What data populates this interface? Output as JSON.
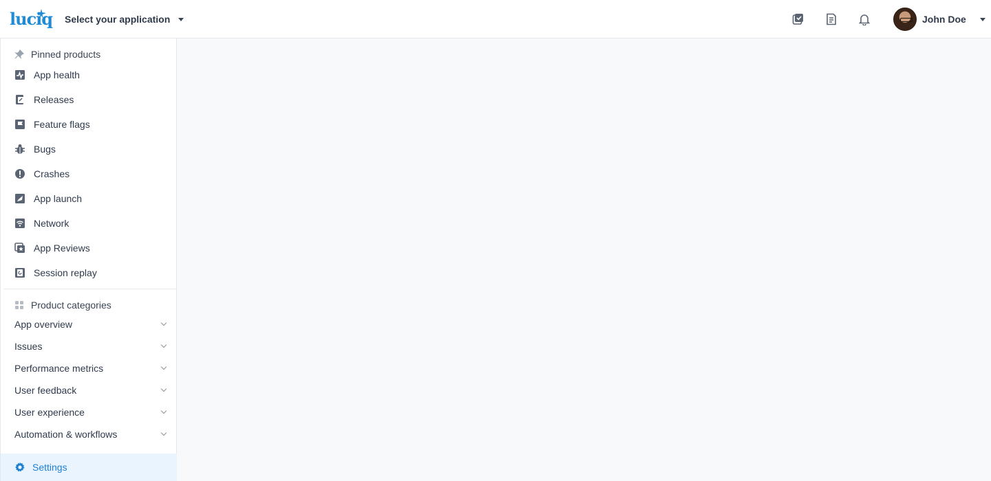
{
  "brand": {
    "logo_text": "luciq",
    "accent": "#1f8bd6"
  },
  "header": {
    "app_selector_label": "Select your application",
    "icons": [
      "tasks-icon",
      "notes-icon",
      "bell-icon"
    ],
    "user_name": "John Doe"
  },
  "sidebar": {
    "pinned_heading": "Pinned products",
    "pinned_items": [
      {
        "label": "App health",
        "icon": "app-health-icon"
      },
      {
        "label": "Releases",
        "icon": "releases-icon"
      },
      {
        "label": "Feature flags",
        "icon": "flag-icon"
      },
      {
        "label": "Bugs",
        "icon": "bug-icon"
      },
      {
        "label": "Crashes",
        "icon": "crash-icon"
      },
      {
        "label": "App launch",
        "icon": "rocket-icon"
      },
      {
        "label": "Network",
        "icon": "wifi-icon"
      },
      {
        "label": "App Reviews",
        "icon": "star-icon"
      },
      {
        "label": "Session replay",
        "icon": "replay-icon"
      }
    ],
    "categories_heading": "Product categories",
    "categories": [
      {
        "label": "App overview"
      },
      {
        "label": "Issues"
      },
      {
        "label": "Performance metrics"
      },
      {
        "label": "User feedback"
      },
      {
        "label": "User experience"
      },
      {
        "label": "Automation & workflows"
      }
    ],
    "settings_label": "Settings",
    "settings_color": "#1f7fd1"
  }
}
